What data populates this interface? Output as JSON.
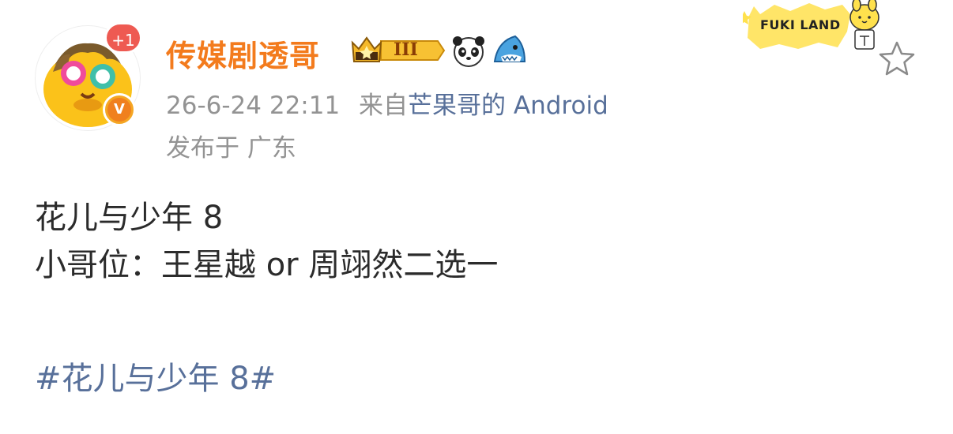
{
  "post": {
    "avatar": {
      "notification_badge": "+1",
      "verified_badge": "V"
    },
    "username": "传媒剧透哥",
    "badges": {
      "level_badge": "III",
      "icons": [
        "crown-icon",
        "panda-emoji-icon",
        "shark-emoji-icon"
      ]
    },
    "meta": {
      "timestamp": "26-6-24 22:11",
      "from_prefix": "来自",
      "source": "芒果哥的 Android",
      "location": "发布于 广东"
    },
    "decoration": {
      "banner_text": "FUKI LAND"
    },
    "content": {
      "line1": "花儿与少年 8",
      "line2": "小哥位：王星越 or 周翊然二选一",
      "hashtag": "#花儿与少年 8#"
    }
  },
  "colors": {
    "username": "#f37b1d",
    "link": "#58709a",
    "meta": "#939393",
    "body_text": "#2b2b2b",
    "badge_red": "#ee5a52",
    "badge_orange": "#f0801e"
  }
}
